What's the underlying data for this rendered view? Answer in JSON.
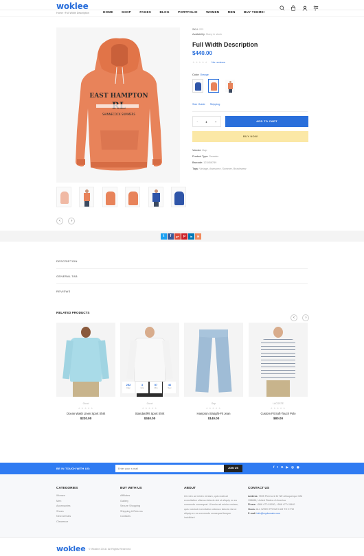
{
  "header": {
    "logo": "woklee",
    "nav": [
      "HOME",
      "SHOP",
      "PAGES",
      "BLOG",
      "PORTFOLIO",
      "WOMEN",
      "MEN",
      "BUY THEME!"
    ],
    "breadcrumb_home": "Home",
    "breadcrumb_sep": "›",
    "breadcrumb_current": "Full Width Description"
  },
  "product": {
    "sku_label": "SKU:",
    "sku_value": "223",
    "availability_label": "Availability:",
    "availability_value": "Many in stock",
    "title": "Full Width Description",
    "price": "$440.00",
    "stars": "★★★★★",
    "reviews_link": "No reviews",
    "color_label": "Color:",
    "color_value": "Orange",
    "size_guide": "Size Guide",
    "shipping": "Shipping",
    "qty_minus": "-",
    "quantity": "1",
    "qty_plus": "+",
    "add_to_cart": "ADD TO CART",
    "buy_now": "BUY NOW",
    "vendor_label": "Vendor:",
    "vendor_value": "Gap",
    "type_label": "Product Type:",
    "type_value": "Sweater",
    "barcode_label": "Barcode:",
    "barcode_value": "123456789",
    "tags_label": "Tags:",
    "tags_value": "Vintage, Awesome, Summer, Beachwear",
    "hoodie_print_1": "EAST HAMPTON",
    "hoodie_print_2": "RL",
    "hoodie_print_3": "SHINNECOCK SUMMERS"
  },
  "share": [
    "t",
    "f",
    "g+",
    "p",
    "in",
    "✉"
  ],
  "tabs": [
    "DESCRIPTION",
    "GENERAL TAB",
    "REVIEWS"
  ],
  "related": {
    "title": "RELATED PRODUCTS",
    "items": [
      {
        "cat": "Gucci",
        "name": "Ocean Wash Linen Sport Shirt",
        "price": "$220.00",
        "stars": "★★★★★"
      },
      {
        "cat": "Gucci",
        "name": "StandardFit Sport Shirt",
        "price": "$340.00",
        "stars": "★★★★★",
        "countdown": [
          {
            "n": "252",
            "u": "Day"
          },
          {
            "n": "3",
            "u": "Hrs"
          },
          {
            "n": "57",
            "u": "Min"
          },
          {
            "n": "46",
            "u": "Sec"
          }
        ]
      },
      {
        "cat": "Gap",
        "name": "Hampton Straight-Fit Jean",
        "price": "$140.00",
        "stars": "★★★★★"
      },
      {
        "cat": "LACOSTE",
        "name": "Custom Fit Soft-Touch Polo",
        "price": "$80.00",
        "stars": "★★★★★"
      }
    ]
  },
  "newsletter": {
    "label": "BE IN TOUCH WITH US:",
    "placeholder": "Enter your e-mail",
    "button": "JOIN US",
    "socials": [
      "f",
      "t",
      "G",
      "▶",
      "◎",
      "◉"
    ]
  },
  "footer": {
    "categories_title": "CATEGORIES",
    "categories": [
      "Women",
      "Men",
      "Accessories",
      "Shoes",
      "New Arrivals",
      "Clearence"
    ],
    "buy_title": "BUY WITH US",
    "buy": [
      "Affiliates",
      "Gallery",
      "Secure Shopping",
      "Shipping & Returns",
      "Contacts"
    ],
    "about_title": "ABOUT",
    "about_text": "Ut enim ad minim veniam, quis nostrud exercitation ullamco laboris nisi ut aliquip ex ea commodo consequat. Ut enim ad minim veniam, quis nostrud exercitation ullamco laboris nisi ut aliquip ex ea commodo consequat tempor incididunt",
    "contact_title": "CONTACT US",
    "address_label": "Address:",
    "address": "7895 Piermont Dr NE Albuquerque NM 198866, United States of America",
    "phone_label": "Phone:",
    "phone": "+566 4774 9930; +566 4774 9940",
    "hours_label": "Hours:",
    "hours": "ALL WEEK FROM 9 AM TO 9 PM",
    "email_label": "E-mail:",
    "email": "info@mydomain.com",
    "copyright": "© Woklee 2018. All Rights Reserved"
  },
  "colors": {
    "accent": "#2a6fdb",
    "buy_now": "#fbe8a6",
    "hoodie": "#e8835a"
  }
}
